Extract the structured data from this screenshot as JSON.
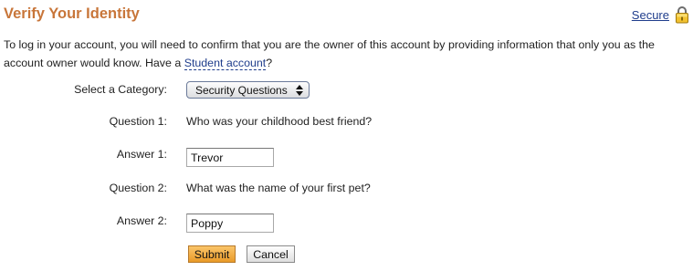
{
  "header": {
    "title": "Verify Your Identity",
    "secure_label": "Secure"
  },
  "intro": {
    "text_before": "To log in your account, you will need to confirm that you are the owner of this account by providing information that only you as the account owner would know. Have a ",
    "link_text": "Student account",
    "text_after": "?"
  },
  "form": {
    "category_label": "Select a Category:",
    "category_value": "Security Questions",
    "question1_label": "Question 1:",
    "question1_text": "Who was your childhood best friend?",
    "answer1_label": "Answer 1:",
    "answer1_value": "Trevor",
    "question2_label": "Question 2:",
    "question2_text": "What was the name of your first pet?",
    "answer2_label": "Answer 2:",
    "answer2_value": "Poppy"
  },
  "buttons": {
    "submit_label": "Submit",
    "cancel_label": "Cancel"
  },
  "colors": {
    "title": "#c8763a",
    "link": "#1f3d8c",
    "submit": "#f0ac3f"
  },
  "icons": {
    "secure": "lock-icon",
    "select": "updown-arrows-icon"
  }
}
